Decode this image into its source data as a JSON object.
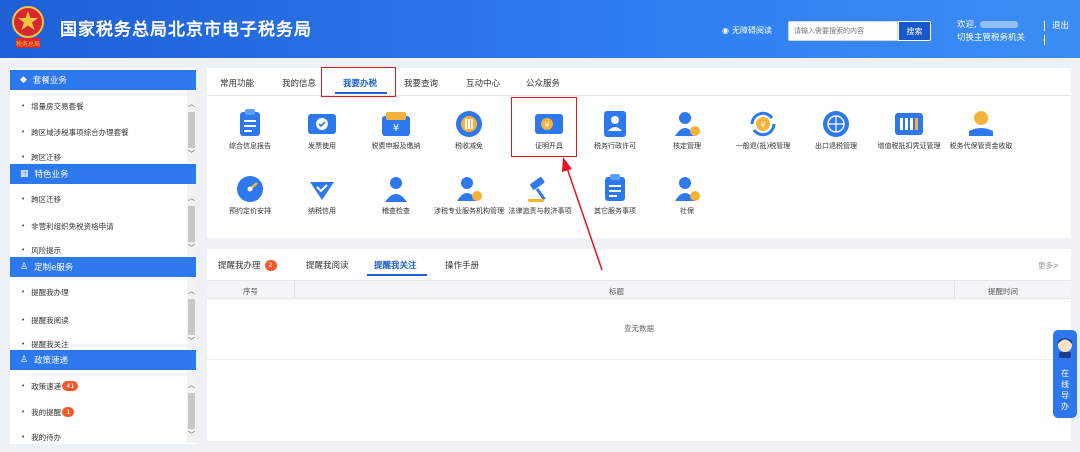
{
  "header": {
    "site_title": "国家税务总局北京市电子税务局",
    "accessibility_label": "无障碍阅读",
    "search_placeholder": "请输入需要搜索的内容",
    "search_button": "搜索",
    "welcome": "欢迎,",
    "switch_agency": "切换主管税务机关",
    "logout": "退出",
    "emblem_caption": "税务总局"
  },
  "sidebar": {
    "groups": [
      {
        "title": "套餐业务",
        "items": [
          "增量房交易套餐",
          "跨区域涉税事项综合办理套餐",
          "跨区迁移"
        ]
      },
      {
        "title": "特色业务",
        "items": [
          "跨区迁移",
          "非营利组织免税资格申请",
          "风险提示"
        ]
      },
      {
        "title": "定制e服务",
        "items": [
          "提醒我办理",
          "提醒我阅读",
          "提醒我关注"
        ]
      },
      {
        "title": "政策速递",
        "items": [
          {
            "label": "政策速递",
            "badge": "41"
          },
          {
            "label": "我的提醒",
            "badge": "1"
          },
          {
            "label": "我的待办",
            "badge": ""
          }
        ]
      }
    ]
  },
  "tabs": [
    "常用功能",
    "我的信息",
    "我要办税",
    "我要查询",
    "互动中心",
    "公众服务"
  ],
  "active_tab": "我要办税",
  "services": [
    {
      "label": "综合信息报告",
      "icon": "report-icon"
    },
    {
      "label": "发票使用",
      "icon": "invoice-icon"
    },
    {
      "label": "税费申报及缴纳",
      "icon": "tax-declare-icon"
    },
    {
      "label": "税收减免",
      "icon": "tax-relief-icon"
    },
    {
      "label": "证明开具",
      "icon": "certificate-icon"
    },
    {
      "label": "税务行政许可",
      "icon": "admin-license-icon"
    },
    {
      "label": "核定管理",
      "icon": "assessment-icon"
    },
    {
      "label": "一般退(抵)税管理",
      "icon": "tax-refund-icon"
    },
    {
      "label": "出口退税管理",
      "icon": "export-refund-icon"
    },
    {
      "label": "增值税抵扣凭证管理",
      "icon": "vat-voucher-icon"
    },
    {
      "label": "税务代保管资金收取",
      "icon": "custody-fund-icon"
    },
    {
      "label": "预约定价安排",
      "icon": "pricing-icon"
    },
    {
      "label": "纳税信用",
      "icon": "credit-icon"
    },
    {
      "label": "稽查检查",
      "icon": "inspection-icon"
    },
    {
      "label": "涉税专业服务机构管理",
      "icon": "agency-icon"
    },
    {
      "label": "法律追责与救济事项",
      "icon": "legal-icon"
    },
    {
      "label": "其它服务事项",
      "icon": "other-service-icon"
    },
    {
      "label": "社保",
      "icon": "social-security-icon"
    }
  ],
  "reminder": {
    "tabs": [
      {
        "label": "提醒我办理",
        "badge": "2"
      },
      {
        "label": "提醒我阅读",
        "badge": ""
      },
      {
        "label": "提醒我关注",
        "badge": ""
      },
      {
        "label": "操作手册",
        "badge": ""
      }
    ],
    "active_tab": "提醒我关注",
    "more": "更多>",
    "columns": [
      "序号",
      "标题",
      "提醒时间"
    ],
    "empty": "查无数据"
  },
  "guide": {
    "label": [
      "在",
      "线",
      "导",
      "办"
    ]
  },
  "colors": {
    "header_blue": "#2f7ff0",
    "accent": "#1f5fd0",
    "highlight_red": "#e4151d",
    "badge_orange": "#f25c2c"
  }
}
